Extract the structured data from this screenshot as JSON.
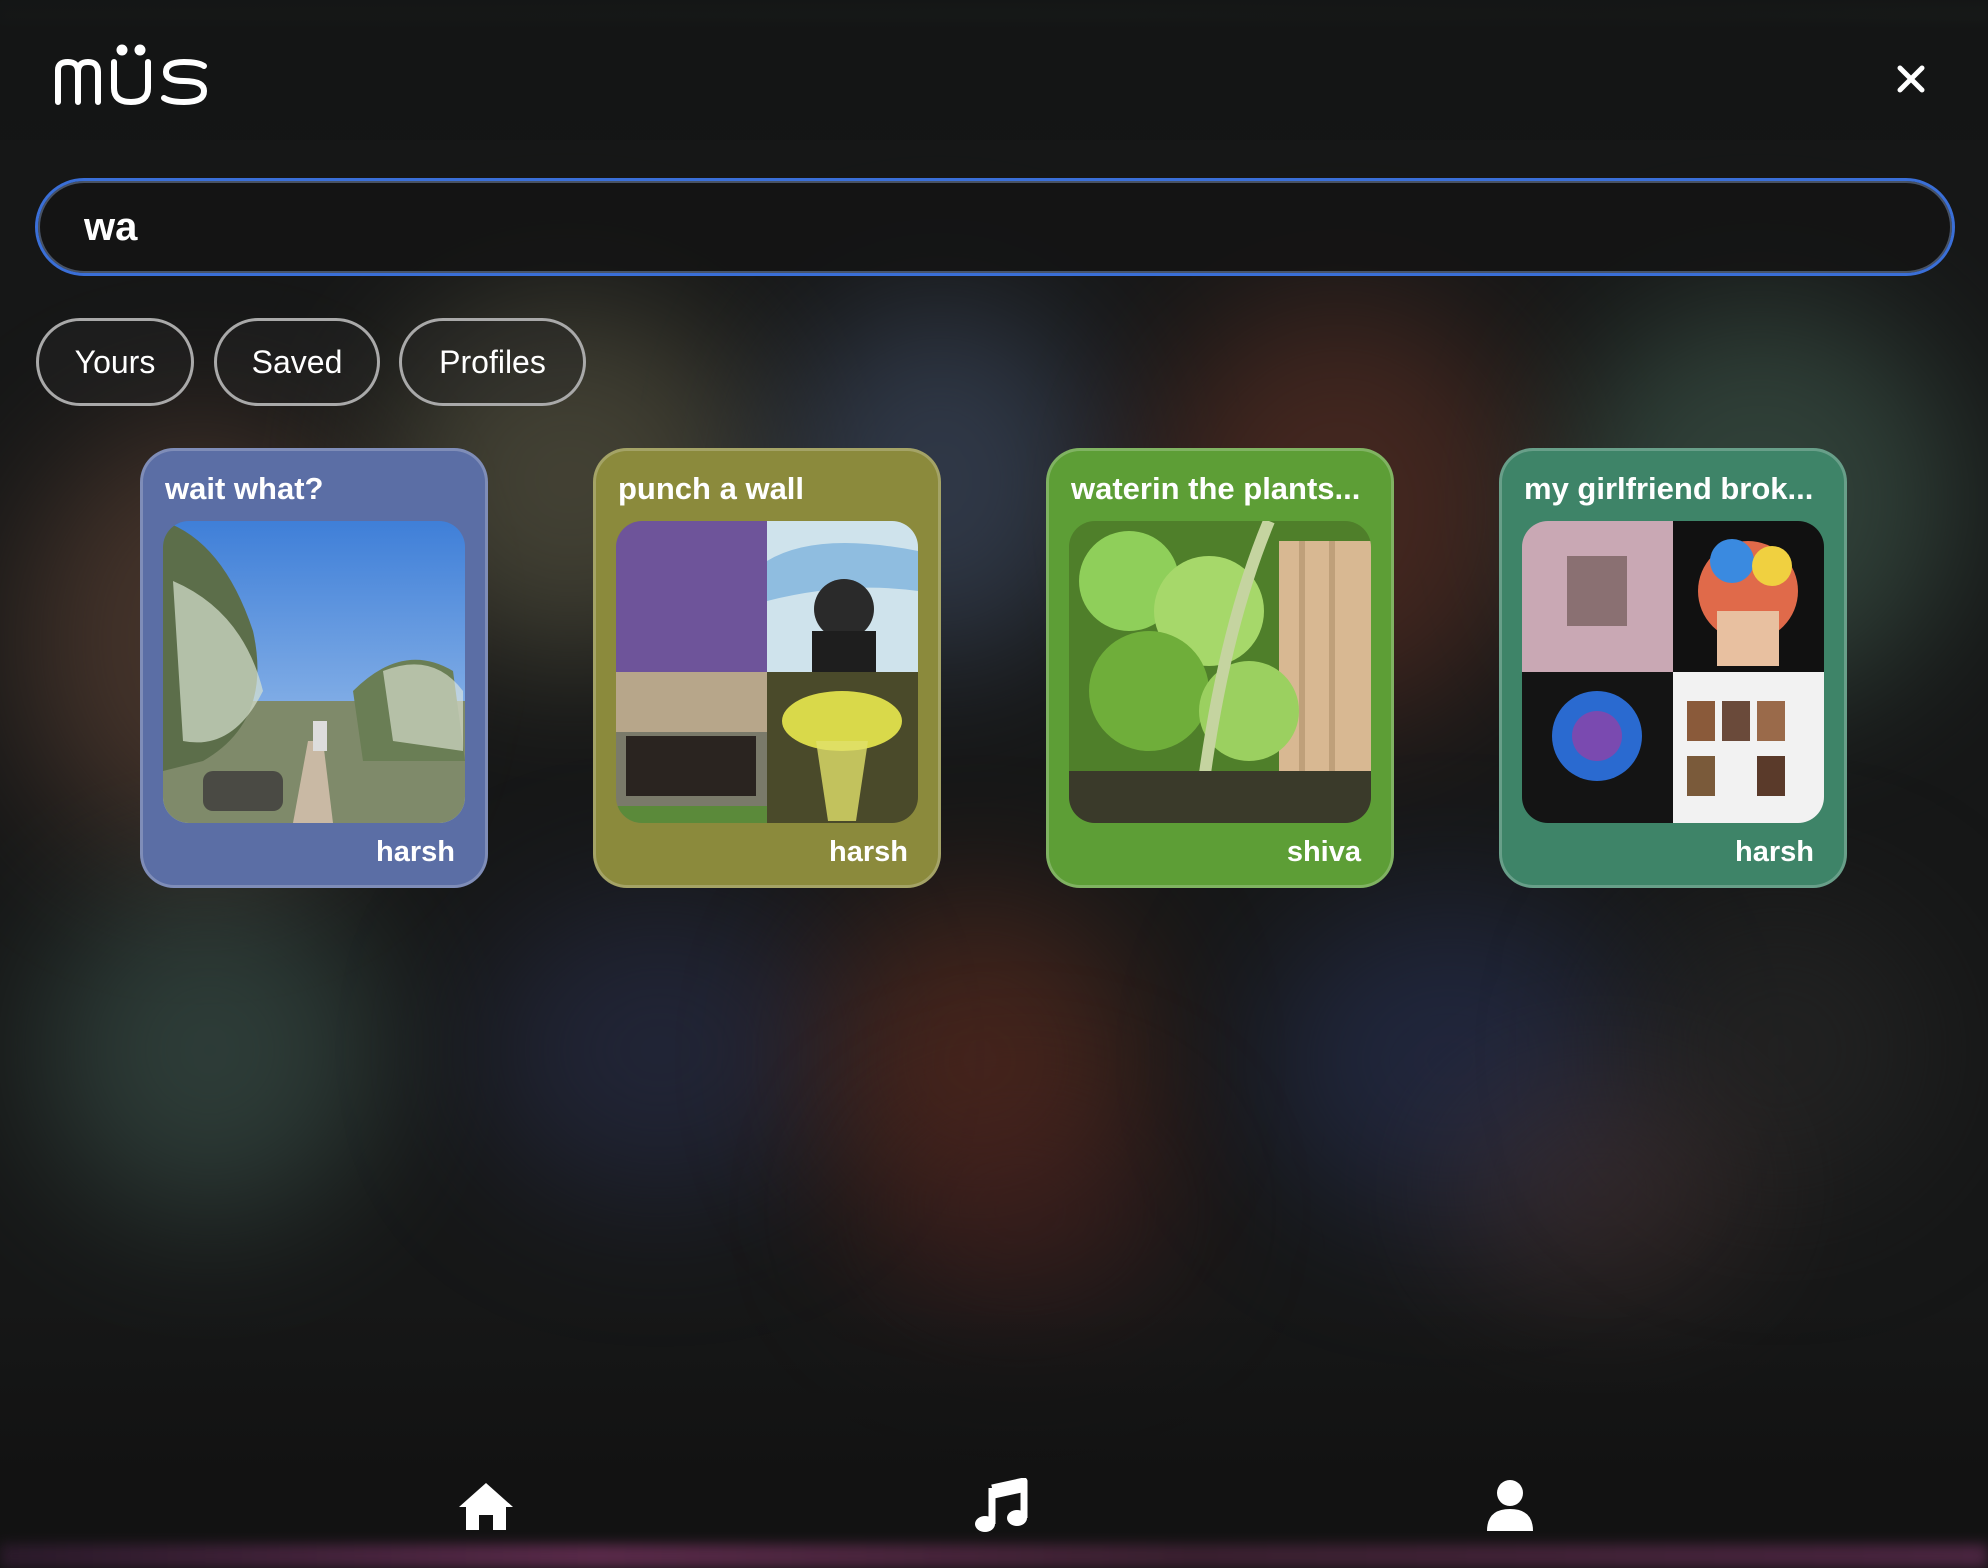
{
  "app": {
    "logo_text": "müs"
  },
  "search": {
    "value": "wa",
    "placeholder": ""
  },
  "filters": [
    {
      "label": "Yours"
    },
    {
      "label": "Saved"
    },
    {
      "label": "Profiles"
    }
  ],
  "results": [
    {
      "title": "wait what?",
      "user": "harsh",
      "color": "#5b6ea5"
    },
    {
      "title": "punch a wall",
      "user": "harsh",
      "color": "#8b8a3c"
    },
    {
      "title": "waterin the plants...",
      "user": "shiva",
      "color": "#5d9e36"
    },
    {
      "title": "my girlfriend brok...",
      "user": "harsh",
      "color": "#3e8468"
    }
  ],
  "nav": [
    {
      "icon": "home-icon"
    },
    {
      "icon": "music-note-icon"
    },
    {
      "icon": "profile-icon"
    }
  ],
  "colors": {
    "accent": "#3a6fd8",
    "background": "#161717"
  }
}
